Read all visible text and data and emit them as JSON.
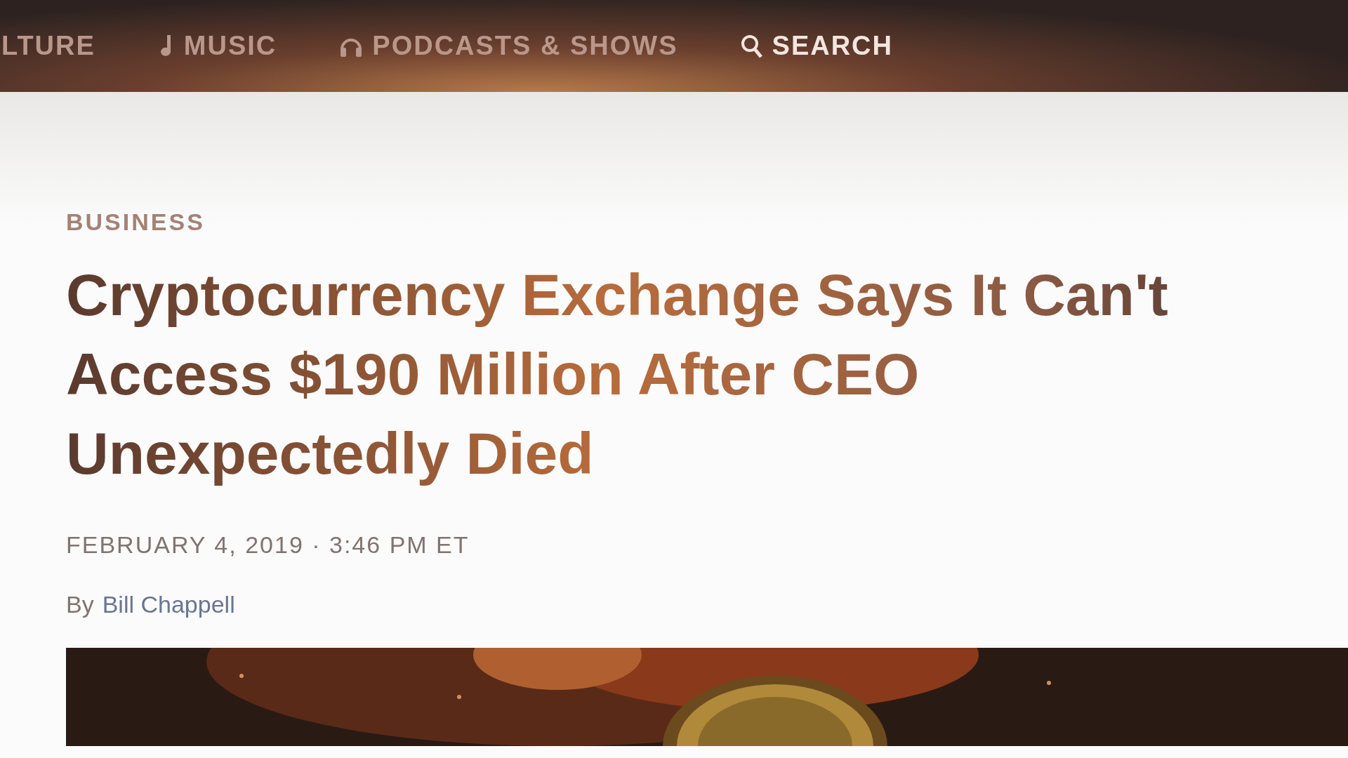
{
  "nav": {
    "items": [
      {
        "label": "LTURE",
        "kind": "plain"
      },
      {
        "label": "MUSIC",
        "kind": "music"
      },
      {
        "label": "PODCASTS & SHOWS",
        "kind": "podcasts"
      },
      {
        "label": "SEARCH",
        "kind": "search"
      }
    ]
  },
  "article": {
    "section": "BUSINESS",
    "headline": "Cryptocurrency Exchange Says It Can't Access $190 Million After CEO Unexpectedly Died",
    "dateline": "FEBRUARY 4, 2019 · 3:46 PM ET",
    "byline_prefix": "By",
    "author": "Bill Chappell"
  }
}
